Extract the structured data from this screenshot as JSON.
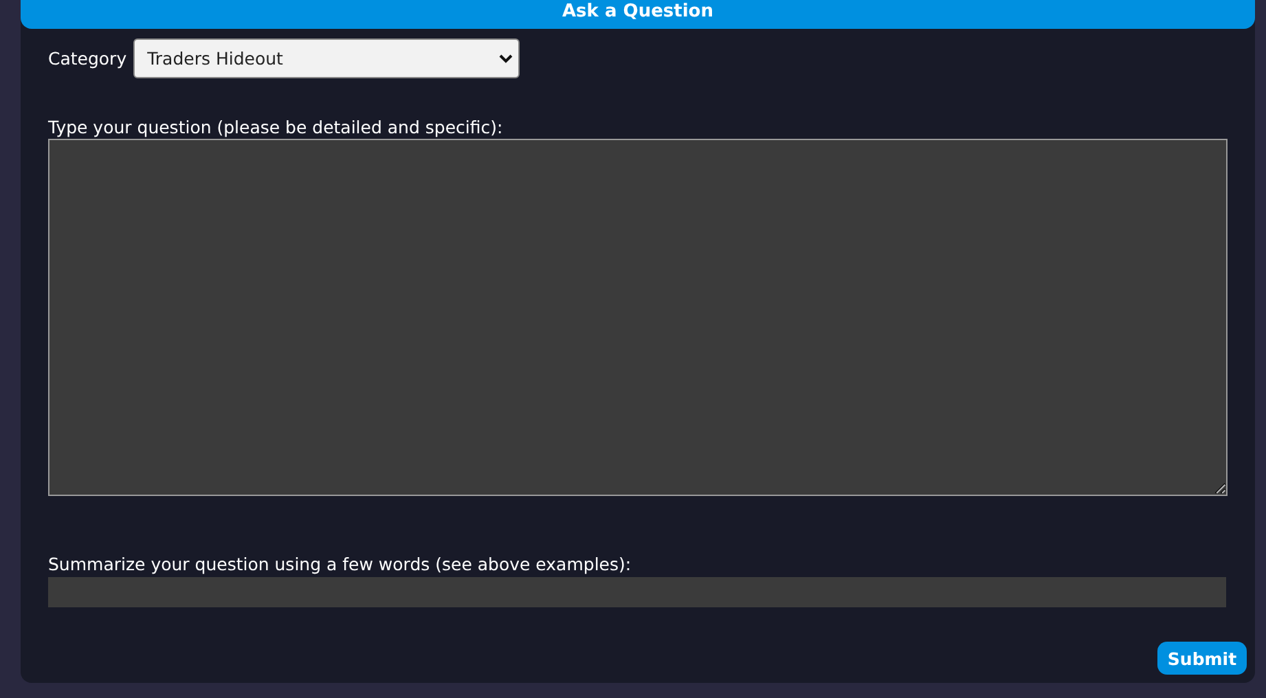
{
  "header": {
    "title": "Ask a Question"
  },
  "category": {
    "label": "Category",
    "value": "Traders Hideout"
  },
  "question": {
    "label": "Type your question (please be detailed and specific):"
  },
  "summary": {
    "label": "Summarize your question using a few words (see above examples):"
  },
  "submit": {
    "label": "Submit"
  }
}
